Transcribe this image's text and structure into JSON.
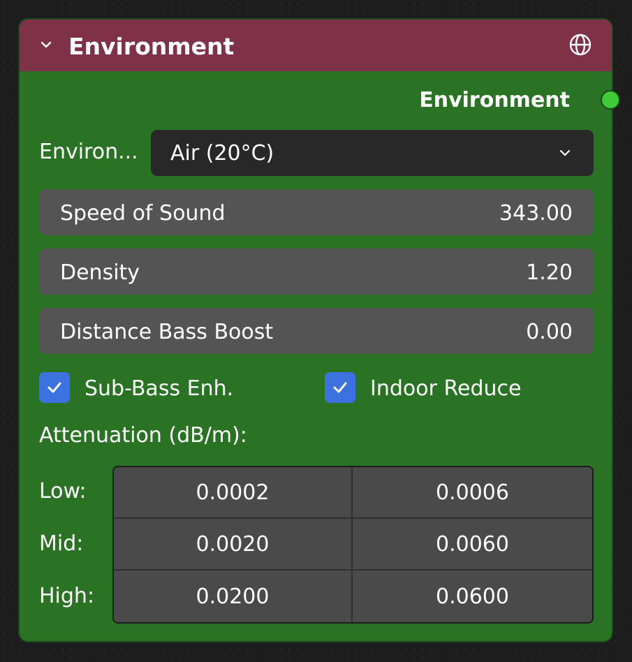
{
  "node": {
    "title": "Environment",
    "header_color": "#7e3147",
    "body_color": "#2a7325",
    "collapse_icon": "chevron-down-icon",
    "header_icon": "globe-icon"
  },
  "output": {
    "label": "Environment",
    "socket_color": "#3ecb35"
  },
  "environment_select": {
    "label": "Environ...",
    "value": "Air (20°C)",
    "icon": "chevron-down-icon"
  },
  "fields": [
    {
      "label": "Speed of Sound",
      "value": "343.00"
    },
    {
      "label": "Density",
      "value": "1.20"
    },
    {
      "label": "Distance Bass Boost",
      "value": "0.00"
    }
  ],
  "checkboxes": [
    {
      "label": "Sub-Bass Enh.",
      "checked": true
    },
    {
      "label": "Indoor Reduce",
      "checked": true
    }
  ],
  "checkbox_color": "#3b72e0",
  "attenuation": {
    "title": "Attenuation (dB/m):",
    "rows": [
      {
        "label": "Low:",
        "values": [
          "0.0002",
          "0.0006"
        ]
      },
      {
        "label": "Mid:",
        "values": [
          "0.0020",
          "0.0060"
        ]
      },
      {
        "label": "High:",
        "values": [
          "0.0200",
          "0.0600"
        ]
      }
    ]
  }
}
